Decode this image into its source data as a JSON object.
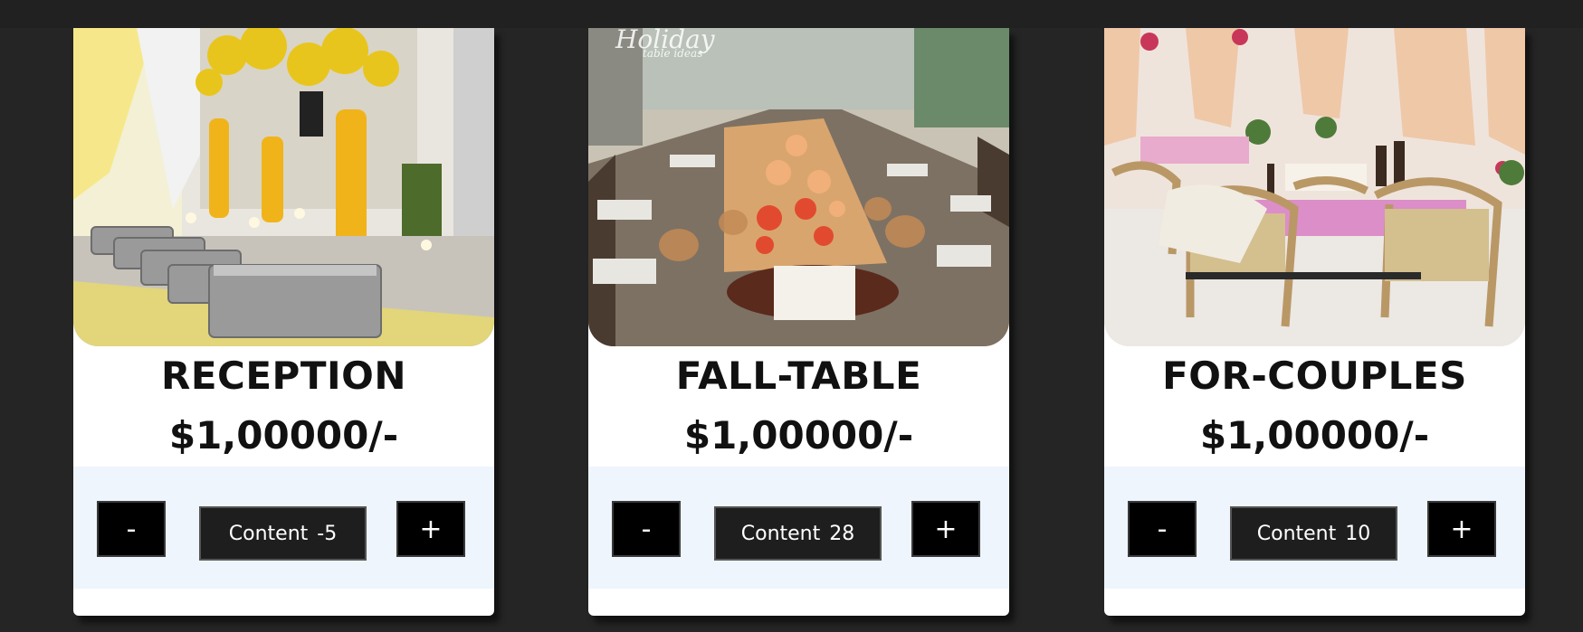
{
  "cards": [
    {
      "title": "RECEPTION",
      "price": "$1,00000/-",
      "minus_label": "-",
      "plus_label": "+",
      "content_label": "Content",
      "content_value": "-5",
      "image": "catering buffet with lemon centerpieces"
    },
    {
      "title": "FALL-TABLE",
      "price": "$1,00000/-",
      "minus_label": "-",
      "plus_label": "+",
      "content_label": "Content",
      "content_value": "28",
      "image": "long dining table with floral runner",
      "image_text": "Holiday table ideas"
    },
    {
      "title": "FOR-COUPLES",
      "price": "$1,00000/-",
      "minus_label": "-",
      "plus_label": "+",
      "content_label": "Content",
      "content_value": "10",
      "image": "outdoor cafe tables with pink linens"
    }
  ],
  "colors": {
    "background": "#252525",
    "card": "#ffffff",
    "controls_panel": "#eef5fc",
    "button": "#000000"
  }
}
